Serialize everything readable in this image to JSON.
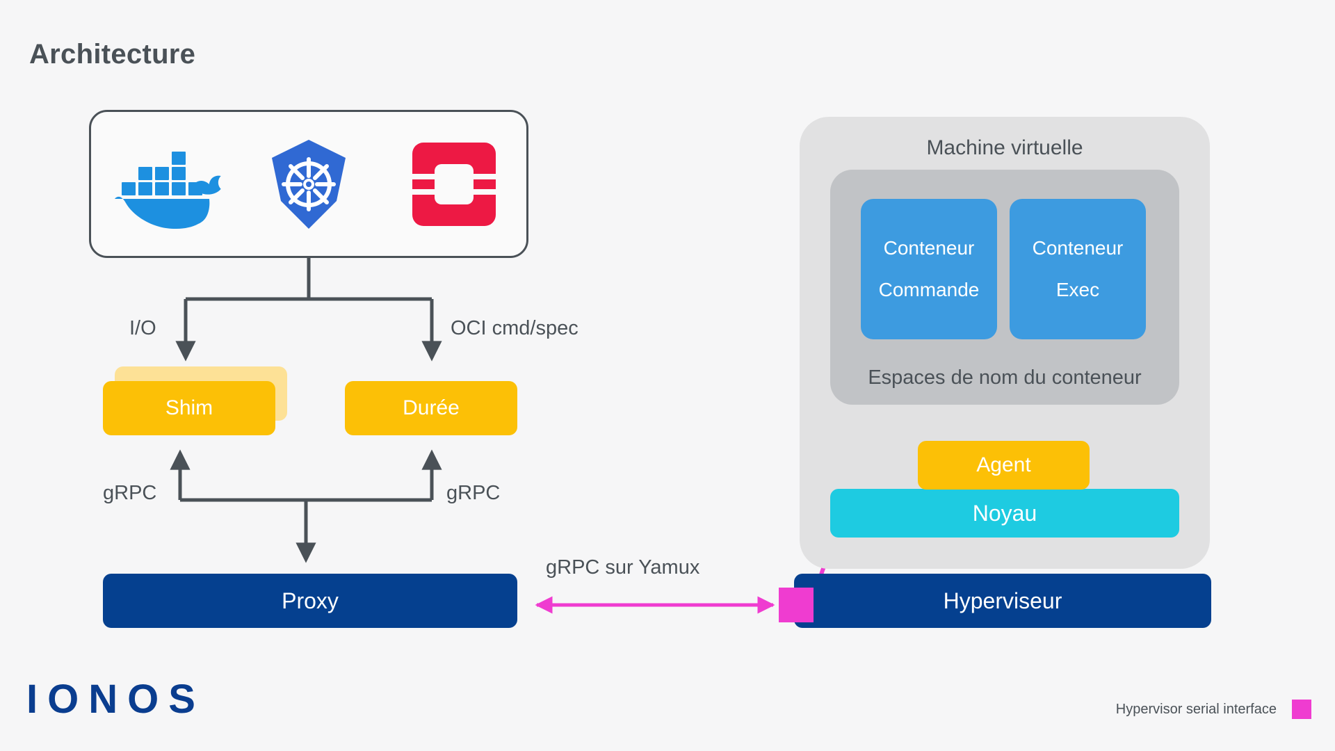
{
  "page": {
    "title": "Architecture",
    "background_color": "#f6f6f7"
  },
  "colors": {
    "title_text": "#4a5157",
    "stroke": "#4a5157",
    "yellow": "#fcc006",
    "yellow_light": "#fde196",
    "navy": "#05408f",
    "cyan": "#1ecbe1",
    "blue": "#3d9be0",
    "magenta": "#ef3cd0",
    "vm_panel": "#e1e1e2",
    "ns_panel": "#c1c3c6",
    "docker_blue": "#1d90e0",
    "kubernetes_blue": "#3069d3",
    "openstack_red": "#ed1944",
    "ionos_navy": "#0a3d8f"
  },
  "runtimes": {
    "logos": [
      {
        "name": "docker-logo",
        "label": "Docker"
      },
      {
        "name": "kubernetes-logo",
        "label": "Kubernetes"
      },
      {
        "name": "openstack-logo",
        "label": "OpenStack"
      }
    ]
  },
  "edges": {
    "io": "I/O",
    "oci": "OCI cmd/spec",
    "grpc_left": "gRPC",
    "grpc_right": "gRPC",
    "yamux": "gRPC sur Yamux"
  },
  "nodes": {
    "shim": "Shim",
    "duree": "Durée",
    "proxy": "Proxy",
    "agent": "Agent",
    "noyau": "Noyau",
    "hyperviseur": "Hyperviseur"
  },
  "vm": {
    "title": "Machine virtuelle",
    "namespace_label": "Espaces de nom du conteneur",
    "containers": [
      {
        "line1": "Conteneur",
        "line2": "Commande"
      },
      {
        "line1": "Conteneur",
        "line2": "Exec"
      }
    ]
  },
  "brand": {
    "logo_text": "IONOS"
  },
  "legend": {
    "label": "Hypervisor serial interface",
    "swatch_color": "#ef3cd0"
  }
}
